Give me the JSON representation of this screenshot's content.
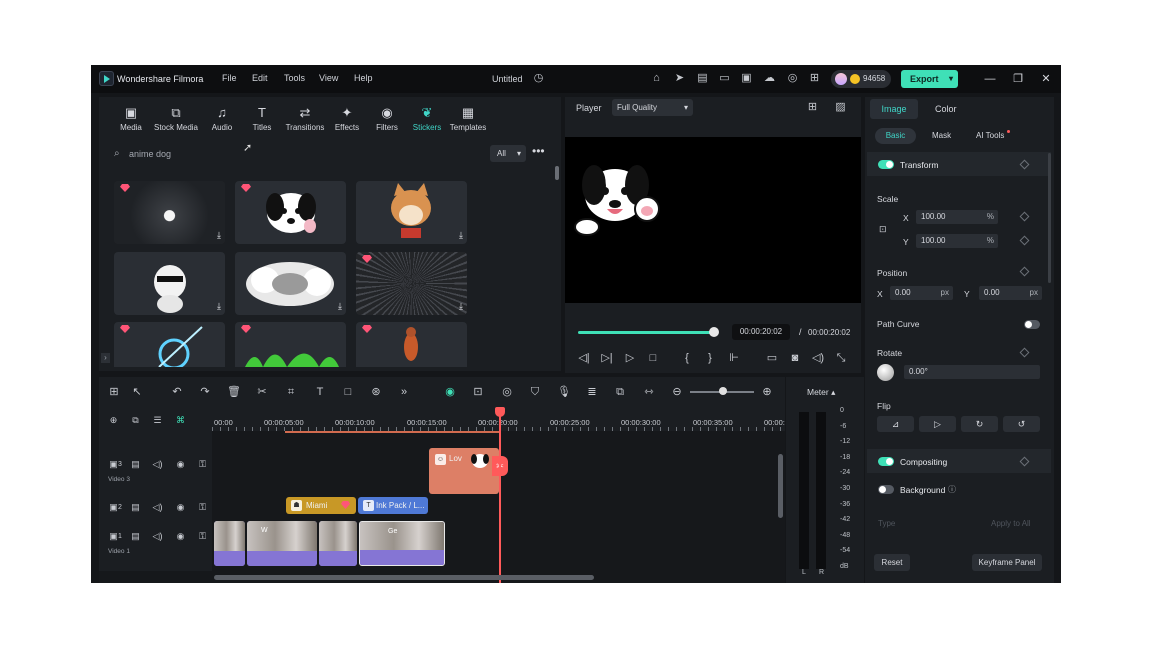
{
  "app": {
    "name": "Wondershare Filmora",
    "document_title": "Untitled",
    "coins": "94658",
    "export_label": "Export"
  },
  "menu": [
    "File",
    "Edit",
    "Tools",
    "View",
    "Help"
  ],
  "categories": [
    "Media",
    "Stock Media",
    "Audio",
    "Titles",
    "Transitions",
    "Effects",
    "Filters",
    "Stickers",
    "Templates"
  ],
  "active_category": "Stickers",
  "search": {
    "value": "anime dog",
    "filter": "All"
  },
  "player": {
    "label": "Player",
    "quality": "Full Quality",
    "current_time": "00:00:20:02",
    "separator": "/",
    "total_time": "00:00:20:02",
    "progress": 1.0
  },
  "properties": {
    "tabs": [
      "Image",
      "Color"
    ],
    "subtabs": [
      "Basic",
      "Mask",
      "AI Tools"
    ],
    "transform": "Transform",
    "scale": {
      "label": "Scale",
      "x_label": "X",
      "x": "100.00",
      "y_label": "Y",
      "y": "100.00",
      "unit": "%"
    },
    "position": {
      "label": "Position",
      "x_label": "X",
      "x": "0.00",
      "y_label": "Y",
      "y": "0.00",
      "unit": "px"
    },
    "path_curve": "Path Curve",
    "rotate": {
      "label": "Rotate",
      "value": "0.00°"
    },
    "flip": "Flip",
    "compositing": "Compositing",
    "background": "Background",
    "type_label": "Type",
    "apply_all": "Apply to All",
    "reset": "Reset",
    "keyframe_panel": "Keyframe Panel"
  },
  "meter": {
    "title": "Meter",
    "levels": [
      "0",
      "-6",
      "-12",
      "-18",
      "-24",
      "-30",
      "-36",
      "-42",
      "-48",
      "-54",
      "dB"
    ],
    "left": "L",
    "right": "R"
  },
  "timeline": {
    "ruler": [
      "00:00",
      "00:00:05:00",
      "00:00:10:00",
      "00:00:15:00",
      "00:00:20:00",
      "00:00:25:00",
      "00:00:30:00",
      "00:00:35:00",
      "00:00:"
    ],
    "tracks": [
      {
        "num": "3",
        "name": "Video 3"
      },
      {
        "num": "2",
        "name": ""
      },
      {
        "num": "1",
        "name": "Video 1"
      }
    ],
    "clips": {
      "love": "Lov",
      "miami": "Miami",
      "ink": "Ink Pack / L...",
      "vclip2": "W",
      "vclip4": "Ge"
    }
  },
  "colors": {
    "accent": "#3fe0b7",
    "playhead": "#ff5a5a",
    "panel": "#1b1e22"
  }
}
